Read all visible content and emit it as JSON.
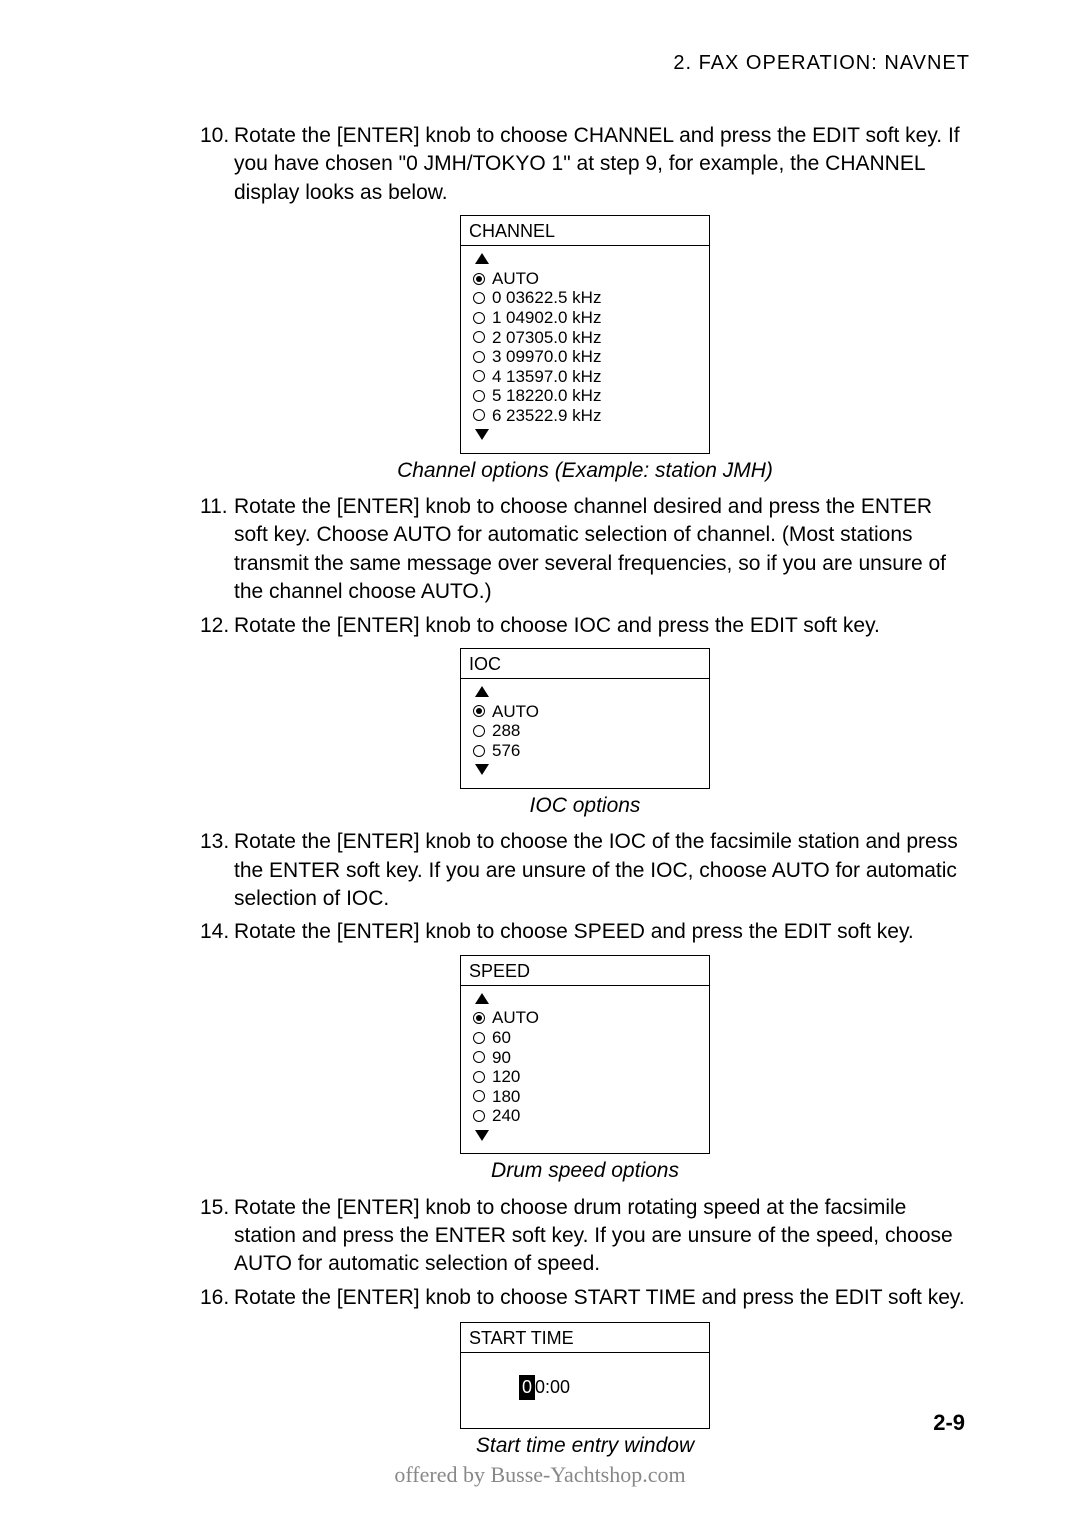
{
  "header": "2.  FAX  OPERATION:  NAVNET",
  "items": [
    {
      "num": "10.",
      "text": "Rotate the [ENTER] knob to choose CHANNEL and press the EDIT soft key. If you have chosen \"0 JMH/TOKYO 1\" at step 9, for example, the CHANNEL display looks as below."
    },
    {
      "num": "11.",
      "text": "Rotate the [ENTER] knob to choose channel desired and press the ENTER soft key. Choose AUTO for automatic selection of channel. (Most stations transmit the same message over several frequencies, so if you are unsure of the channel choose AUTO.)"
    },
    {
      "num": "12.",
      "text": "Rotate the [ENTER] knob to choose IOC and press the EDIT soft key."
    },
    {
      "num": "13.",
      "text": "Rotate the [ENTER] knob to choose the IOC of the facsimile station and press the ENTER soft key. If you are unsure of the IOC, choose AUTO for automatic selection of IOC."
    },
    {
      "num": "14.",
      "text": "Rotate the [ENTER] knob to choose SPEED and press the EDIT soft key."
    },
    {
      "num": "15.",
      "text": "Rotate the [ENTER] knob to choose drum rotating speed at the facsimile station and press the ENTER soft key. If you are unsure of the speed, choose AUTO for automatic selection of speed."
    },
    {
      "num": "16.",
      "text": "Rotate the [ENTER] knob to choose START TIME and press the EDIT soft key."
    }
  ],
  "channelBox": {
    "title": "CHANNEL",
    "options": [
      {
        "sel": true,
        "idx": "",
        "label": "AUTO"
      },
      {
        "sel": false,
        "idx": "0",
        "label": "03622.5 kHz"
      },
      {
        "sel": false,
        "idx": "1",
        "label": "04902.0 kHz"
      },
      {
        "sel": false,
        "idx": "2",
        "label": "07305.0 kHz"
      },
      {
        "sel": false,
        "idx": "3",
        "label": "09970.0 kHz"
      },
      {
        "sel": false,
        "idx": "4",
        "label": "13597.0 kHz"
      },
      {
        "sel": false,
        "idx": "5",
        "label": "18220.0 kHz"
      },
      {
        "sel": false,
        "idx": "6",
        "label": "23522.9 kHz"
      }
    ]
  },
  "iocBox": {
    "title": "IOC",
    "options": [
      {
        "sel": true,
        "label": "AUTO"
      },
      {
        "sel": false,
        "label": "288"
      },
      {
        "sel": false,
        "label": "576"
      }
    ]
  },
  "speedBox": {
    "title": "SPEED",
    "options": [
      {
        "sel": true,
        "label": "AUTO"
      },
      {
        "sel": false,
        "label": "60"
      },
      {
        "sel": false,
        "label": "90"
      },
      {
        "sel": false,
        "label": "120"
      },
      {
        "sel": false,
        "label": "180"
      },
      {
        "sel": false,
        "label": "240"
      }
    ]
  },
  "startTimeBox": {
    "title": "START TIME",
    "valueCursor": "0",
    "valueRest": "0:00"
  },
  "captions": {
    "channel": "Channel options (Example: station JMH)",
    "ioc": "IOC options",
    "speed": "Drum speed options",
    "start": "Start time entry window"
  },
  "pageNum": "2-9",
  "footer": "offered by Busse-Yachtshop.com"
}
